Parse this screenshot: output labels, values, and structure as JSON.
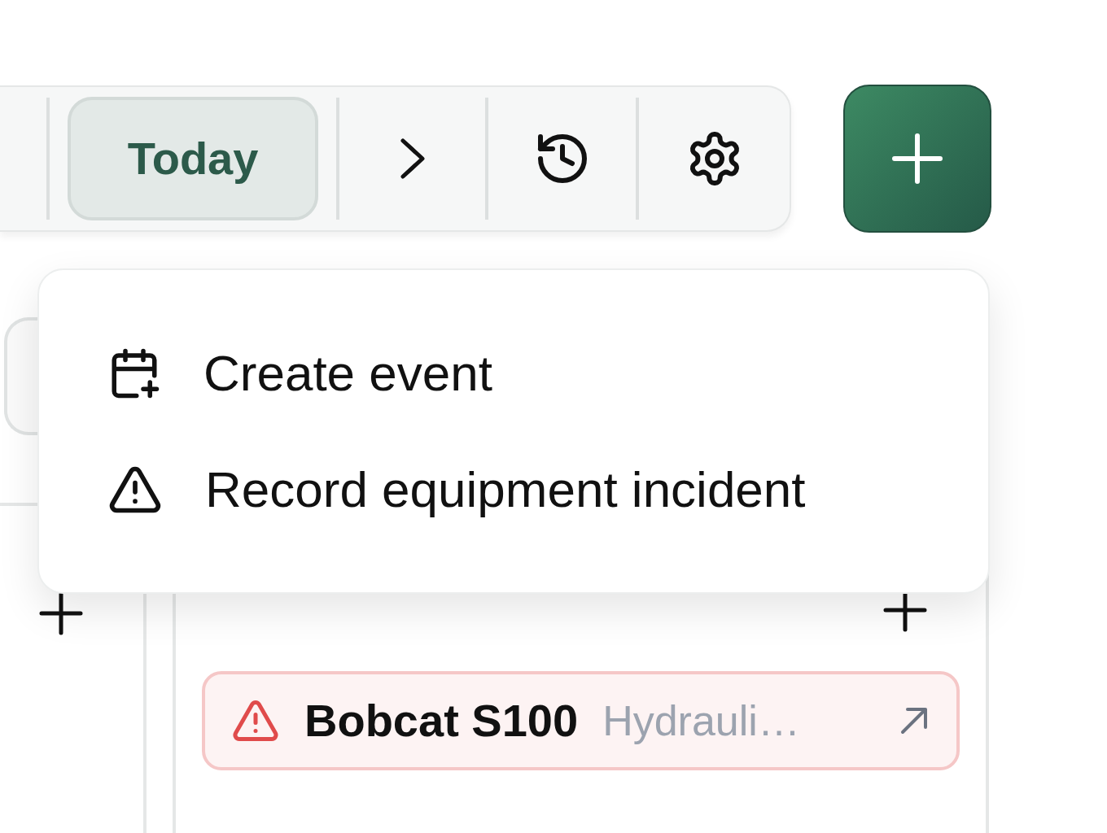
{
  "toolbar": {
    "today_button": "Today"
  },
  "add_menu": {
    "items": [
      {
        "kind": "calendar",
        "label": "Create event"
      },
      {
        "kind": "incident",
        "label": "Record equipment incident"
      }
    ]
  },
  "day_column": {
    "events": [
      {
        "kind": "incident",
        "title": "Bobcat S100",
        "detail": "Hydrauli…"
      }
    ]
  }
}
